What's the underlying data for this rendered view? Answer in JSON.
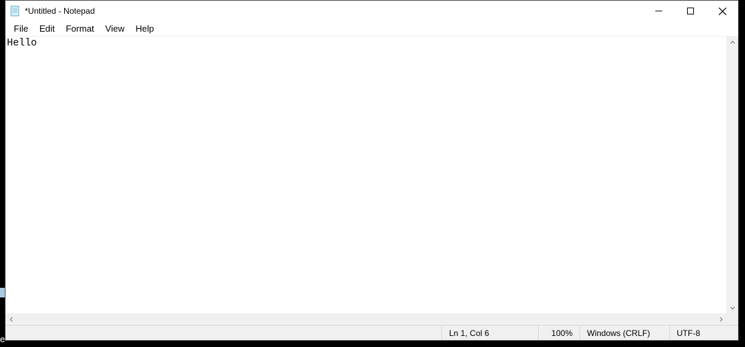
{
  "window": {
    "title": "*Untitled - Notepad"
  },
  "menu": {
    "file": "File",
    "edit": "Edit",
    "format": "Format",
    "view": "View",
    "help": "Help"
  },
  "editor": {
    "content": "Hello"
  },
  "status": {
    "cursor": "Ln 1, Col 6",
    "zoom": "100%",
    "eol": "Windows (CRLF)",
    "encoding": "UTF-8"
  },
  "background": {
    "letter": "e"
  }
}
